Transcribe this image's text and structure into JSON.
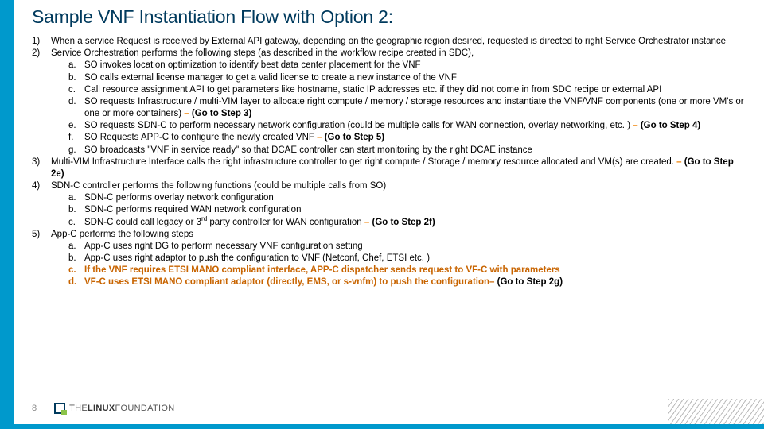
{
  "title": "Sample VNF Instantiation Flow with Option 2:",
  "list": [
    {
      "n": "1)",
      "text": "When a service Request is received by External API gateway, depending on the geographic region desired, requested is directed to right Service Orchestrator instance"
    },
    {
      "n": "2)",
      "text": "Service Orchestration performs the following steps (as described in the workflow recipe created in SDC),",
      "sub": [
        {
          "l": "a.",
          "txt": "SO invokes location optimization to identify best data center placement for the VNF"
        },
        {
          "l": "b.",
          "txt": "SO calls external license manager to get a valid license to create a new instance of the VNF"
        },
        {
          "l": "c.",
          "txt": "Call resource assignment API to get parameters like hostname, static IP addresses etc. if they did not come in from SDC recipe or external API"
        },
        {
          "l": "d.",
          "pre": "SO requests Infrastructure / multi-VIM layer to allocate right compute / memory / storage resources and instantiate the VNF/VNF components (one or more VM's or one or more containers) ",
          "dash": "– ",
          "go": "(Go to Step 3)"
        },
        {
          "l": "e.",
          "pre": "SO requests SDN-C to perform necessary network configuration (could be multiple calls for WAN connection, overlay networking, etc. ) ",
          "dash": "– ",
          "go": "(Go to Step 4)"
        },
        {
          "l": "f.",
          "pre": "SO Requests APP-C to configure the newly created VNF ",
          "dash": "– ",
          "go": "(Go to Step 5)"
        },
        {
          "l": "g.",
          "txt": "SO broadcasts \"VNF in service ready\" so that DCAE controller can start monitoring by the right DCAE instance"
        }
      ]
    },
    {
      "n": "3)",
      "pre": "Multi-VIM Infrastructure Interface calls the right infrastructure controller to get right compute / Storage / memory resource allocated and VM(s) are created. ",
      "dash": "– ",
      "go": "(Go to Step 2e)"
    },
    {
      "n": "4)",
      "text": "SDN-C controller performs the following functions (could be multiple calls from SO)",
      "sub": [
        {
          "l": "a.",
          "txt": "SDN-C performs overlay network configuration"
        },
        {
          "l": "b.",
          "txt": "SDN-C performs required WAN network configuration"
        },
        {
          "l": "c.",
          "pre": "SDN-C could call legacy or 3",
          "sup": "rd",
          "pre2": " party controller for WAN configuration ",
          "dash": "– ",
          "go": "(Go to Step 2f)"
        }
      ]
    },
    {
      "n": "5)",
      "text": "App-C performs the following steps",
      "sub": [
        {
          "l": "a.",
          "txt": "App-C uses right DG to perform necessary VNF configuration setting"
        },
        {
          "l": "b.",
          "txt": "App-C uses right adaptor to push the configuration to VNF (Netconf, Chef, ETSI etc. )"
        },
        {
          "l": "c.",
          "otxt": "If the VNF requires ETSI MANO compliant interface, APP-C dispatcher sends request to VF-C with parameters"
        },
        {
          "l": "d.",
          "opre": "VF-C uses ETSI MANO compliant adaptor (directly, EMS, or s-vnfm) to push the configuration",
          "odash": "– ",
          "go": "(Go to Step 2g)"
        }
      ]
    }
  ],
  "pageNumber": "8",
  "logo": {
    "the": "THE",
    "linux": "LINUX",
    "found": "FOUNDATION"
  }
}
